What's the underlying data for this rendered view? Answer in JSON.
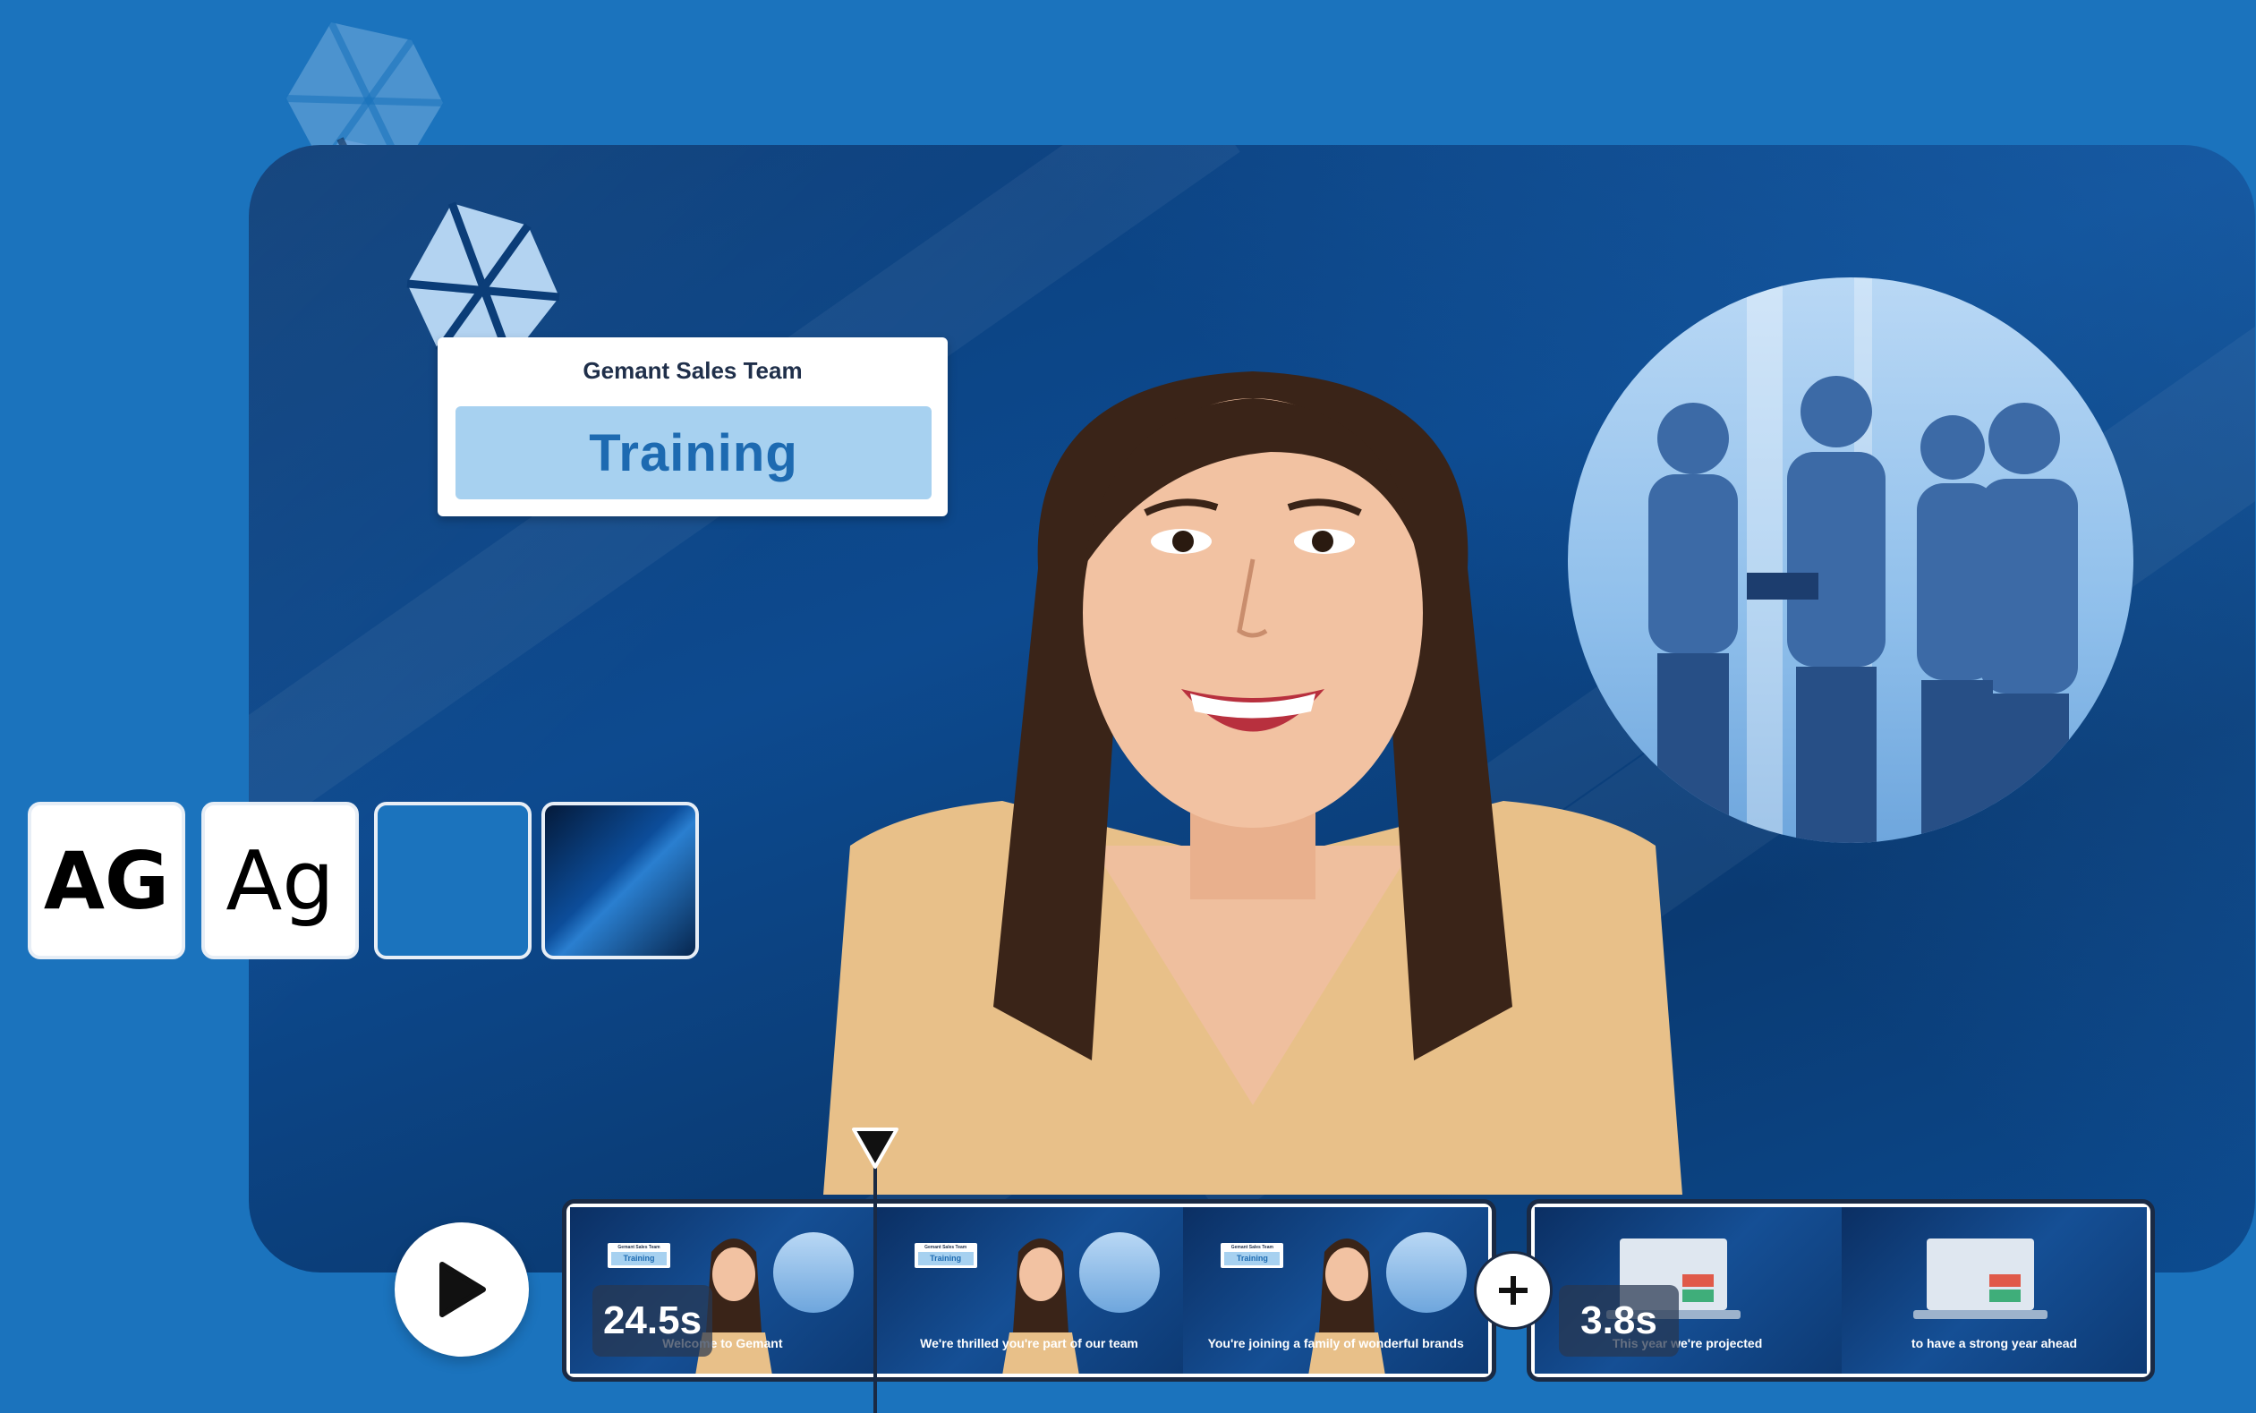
{
  "title_card": {
    "subtitle": "Gemant Sales Team",
    "title": "Training"
  },
  "style_swatches": [
    {
      "label": "AG",
      "kind": "bold-font"
    },
    {
      "label": "Ag",
      "kind": "regular-font"
    },
    {
      "label": "",
      "kind": "solid-color",
      "color": "#1b73bd"
    },
    {
      "label": "",
      "kind": "background-texture"
    }
  ],
  "timeline": {
    "clip_groups": [
      {
        "duration": "24.5s",
        "thumbnails": [
          {
            "caption": "Welcome to Gemant",
            "mini_subtitle": "Gemant Sales Team",
            "mini_title": "Training"
          },
          {
            "caption": "We're thrilled you're part of our team",
            "mini_subtitle": "Gemant Sales Team",
            "mini_title": "Training"
          },
          {
            "caption": "You're joining a family of wonderful brands",
            "mini_subtitle": "Gemant Sales Team",
            "mini_title": "Training"
          }
        ]
      },
      {
        "duration": "3.8s",
        "thumbnails": [
          {
            "caption": "This year we're projected"
          },
          {
            "caption": "to have a strong year ahead"
          }
        ]
      }
    ],
    "add_label": "+"
  },
  "colors": {
    "background": "#1b73bd",
    "accent_light": "#a7d1f0",
    "accent_text": "#1d6ab1",
    "dark_outline": "#1a2a44"
  }
}
